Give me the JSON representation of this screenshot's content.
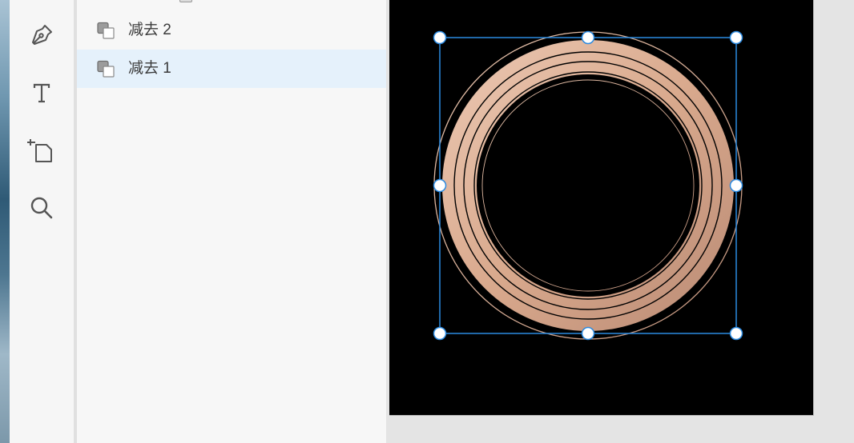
{
  "toolbar": {
    "tools": [
      {
        "name": "pen-tool",
        "icon": "pen-icon"
      },
      {
        "name": "text-tool",
        "icon": "text-icon"
      },
      {
        "name": "artboard-tool",
        "icon": "artboard-icon"
      },
      {
        "name": "zoom-tool",
        "icon": "magnifier-icon"
      }
    ]
  },
  "layers": {
    "items": [
      {
        "label": "减去 2",
        "icon": "subtract-shape-icon",
        "selected": false
      },
      {
        "label": "减去 1",
        "icon": "subtract-shape-icon",
        "selected": true
      }
    ]
  },
  "canvas": {
    "artboard_color": "#000000",
    "selection_color": "#2b8ae0",
    "ring_gradient": [
      "#ecc9b4",
      "#d9a98d",
      "#b98a74"
    ]
  }
}
